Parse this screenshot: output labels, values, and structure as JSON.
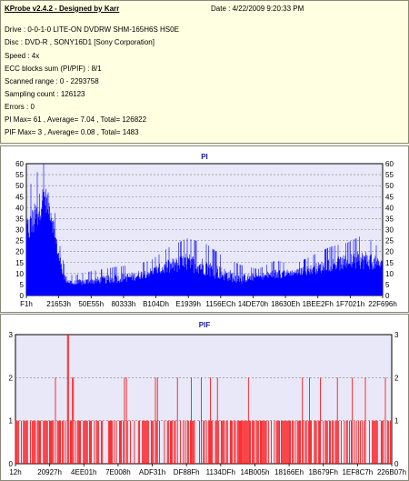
{
  "info": {
    "title": "KProbe v2.4.2 - Designed by Karr",
    "date": "Date : 4/22/2009 9:20:33 PM",
    "lines": [
      "Drive : 0-0-1-0 LITE-ON DVDRW SHM-165H6S HS0E",
      "Disc : DVD-R , SONY16D1 [Sony Corporation]",
      "Speed : 4x",
      "ECC blocks sum (PI/PIF) : 8/1",
      "Scanned range : 0 - 2293758",
      "Sampling count : 126123",
      "Errors : 0",
      "PI Max= 61 , Average= 7.04 , Total= 126822",
      "PIF Max= 3 , Average= 0.08 , Total= 1483"
    ]
  },
  "colors": {
    "pi": "#0000ff",
    "pif": "#ff0000",
    "plot_bg": "#e8e8f8",
    "grid": "#808080"
  },
  "chart_data": [
    {
      "type": "area",
      "title": "PI",
      "ylim": [
        0,
        60
      ],
      "yticks": [
        0,
        5,
        10,
        15,
        20,
        25,
        30,
        35,
        40,
        45,
        50,
        55,
        60
      ],
      "xtick_labels": [
        "F1h",
        "21653h",
        "50E55h",
        "80333h",
        "B104Dh",
        "E1939h",
        "1156ECh",
        "14DE70h",
        "18630Eh",
        "1BEE2Fh",
        "1F7021h",
        "22F696h"
      ],
      "series": [
        {
          "profile_x": [
            0,
            0.01,
            0.03,
            0.05,
            0.07,
            0.08,
            0.09,
            0.1,
            0.11,
            0.13,
            0.18,
            0.25,
            0.3,
            0.35,
            0.4,
            0.45,
            0.5,
            0.55,
            0.6,
            0.65,
            0.7,
            0.75,
            0.8,
            0.85,
            0.9,
            0.95,
            1
          ],
          "profile_avg": [
            30,
            28,
            35,
            44,
            36,
            26,
            18,
            11,
            7,
            5,
            6,
            7,
            8,
            10,
            12,
            14,
            12,
            9,
            7,
            8,
            9,
            10,
            11,
            13,
            14,
            15,
            13
          ],
          "profile_max": [
            40,
            50,
            56,
            61,
            52,
            38,
            26,
            18,
            12,
            9,
            11,
            13,
            14,
            16,
            22,
            26,
            24,
            18,
            14,
            12,
            16,
            14,
            18,
            22,
            24,
            28,
            20
          ]
        }
      ]
    },
    {
      "type": "bar",
      "title": "PIF",
      "ylim": [
        0,
        3
      ],
      "yticks": [
        0,
        1,
        2,
        3
      ],
      "xtick_labels": [
        "12h",
        "20927h",
        "4EE01h",
        "7E008h",
        "ADF31h",
        "DF88Fh",
        "1134DFh",
        "14B005h",
        "18166Eh",
        "1B679Fh",
        "1EF8C7h",
        "226B07h"
      ],
      "series": [
        {
          "max_value": 3,
          "max_at": 0.14,
          "level2_fraction": 0.09,
          "level1_density": 0.62
        }
      ]
    }
  ]
}
